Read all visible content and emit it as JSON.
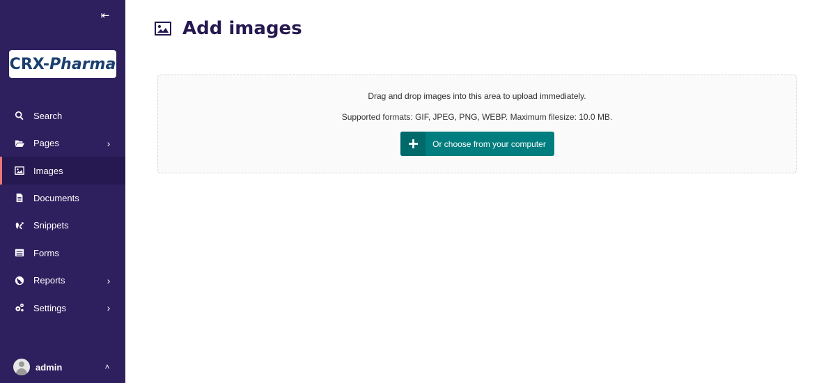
{
  "sidebar": {
    "collapse_icon": "collapse-left-icon",
    "logo": {
      "part1": "CRX-",
      "part2": "Pharma"
    },
    "items": [
      {
        "label": "Search",
        "icon": "search-icon",
        "has_submenu": false
      },
      {
        "label": "Pages",
        "icon": "folder-open-icon",
        "has_submenu": true
      },
      {
        "label": "Images",
        "icon": "image-icon",
        "has_submenu": false,
        "active": true
      },
      {
        "label": "Documents",
        "icon": "document-icon",
        "has_submenu": false
      },
      {
        "label": "Snippets",
        "icon": "snippets-icon",
        "has_submenu": false
      },
      {
        "label": "Forms",
        "icon": "form-icon",
        "has_submenu": false
      },
      {
        "label": "Reports",
        "icon": "globe-icon",
        "has_submenu": true
      },
      {
        "label": "Settings",
        "icon": "cogs-icon",
        "has_submenu": true
      }
    ],
    "account": {
      "name": "admin",
      "icon": "avatar"
    }
  },
  "header": {
    "title": "Add images",
    "icon": "image-icon"
  },
  "dropzone": {
    "instruction": "Drag and drop images into this area to upload immediately.",
    "formats": "Supported formats: GIF, JPEG, PNG, WEBP. Maximum filesize: 10.0 MB.",
    "button_label": "Or choose from your computer",
    "button_icon": "plus-icon"
  },
  "colors": {
    "sidebar_bg": "#2e1f5e",
    "active_item_bg": "#261850",
    "active_indicator": "#e9767b",
    "title_color": "#261850",
    "button_bg": "#007d7e",
    "button_icon_bg": "#006a6b"
  }
}
